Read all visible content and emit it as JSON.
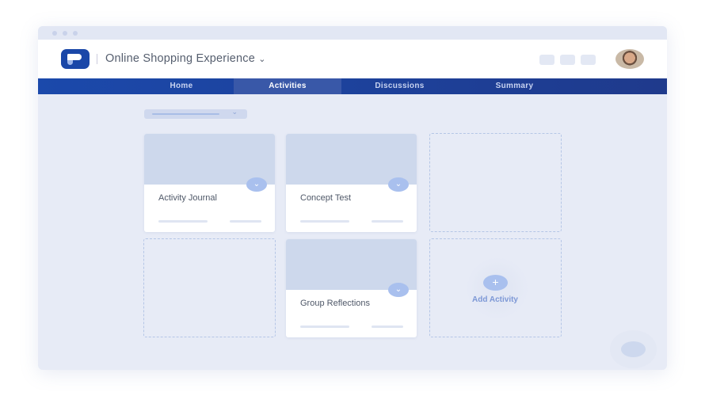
{
  "header": {
    "project_title": "Online Shopping Experience",
    "dropdown_glyph": "⌄"
  },
  "nav": {
    "tabs": [
      {
        "label": "Home"
      },
      {
        "label": "Activities",
        "active": true
      },
      {
        "label": "Discussions"
      },
      {
        "label": "Summary"
      }
    ]
  },
  "filter": {
    "chevron": "⌄"
  },
  "cards": [
    {
      "title": "Activity Journal"
    },
    {
      "title": "Concept Test"
    },
    {
      "title": "Group Reflections"
    }
  ],
  "card_chevron": "⌄",
  "add_activity": {
    "icon": "+",
    "label": "Add Activity"
  },
  "colors": {
    "nav": "#1b49ab",
    "accent": "#a9c0ee",
    "bg": "#e7ebf6"
  }
}
